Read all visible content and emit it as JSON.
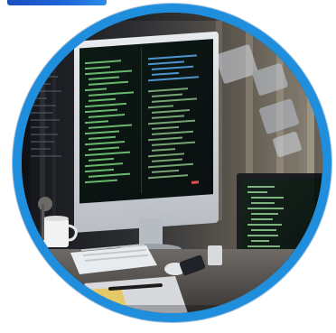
{
  "image": {
    "subject": "developer-workstation-photo",
    "frame_shape": "circle",
    "colors": {
      "ring": "#1f8fdd",
      "top_mark": "#1e63d8",
      "background": "#ffffff",
      "room_dark": "#1b1d22",
      "screen_code_green": "#7bd67e",
      "screen_code_blue": "#5fb3ff"
    },
    "icons": [
      "desktop-monitor",
      "laptop",
      "keyboard",
      "mouse",
      "coffee-mug",
      "table-lamp",
      "pen",
      "floating-ui-panels"
    ]
  }
}
